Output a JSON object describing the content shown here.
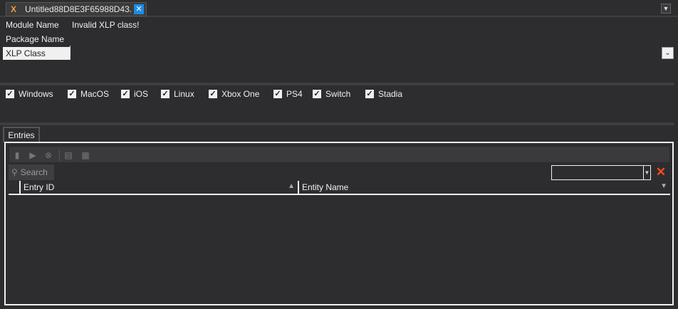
{
  "tab": {
    "icon": "xlp-file-icon",
    "title": "Untitled88D8E3F65988D43...",
    "close_label": "✕"
  },
  "tab_menu": {
    "icon": "dropdown-menu-icon",
    "glyph": "▼"
  },
  "fields": {
    "module_name_label": "Module Name",
    "module_name_value": "Invalid XLP class!",
    "package_name_label": "Package Name",
    "xlp_class_label": "XLP Class",
    "xlp_class_value": "",
    "dropdown_glyph": "⌄"
  },
  "platforms": [
    {
      "label": "Windows",
      "checked": true
    },
    {
      "label": "MacOS",
      "checked": true
    },
    {
      "label": "iOS",
      "checked": true
    },
    {
      "label": "Linux",
      "checked": true
    },
    {
      "label": "Xbox One",
      "checked": true
    },
    {
      "label": "PS4",
      "checked": true
    },
    {
      "label": "Switch",
      "checked": true
    },
    {
      "label": "Stadia",
      "checked": true
    }
  ],
  "checkmark": "✓",
  "entries": {
    "tab_label": "Entries",
    "toolbar_icons": [
      "add-row-icon",
      "insert-row-icon",
      "delete-row-icon",
      "copy-icon",
      "paste-icon"
    ],
    "search_label": "Search",
    "search_value": "",
    "clear_glyph": "✕",
    "columns": [
      {
        "label": "Entry ID",
        "sort": "▲"
      },
      {
        "label": "Entity Name",
        "sort": "▼"
      }
    ],
    "rows": []
  }
}
